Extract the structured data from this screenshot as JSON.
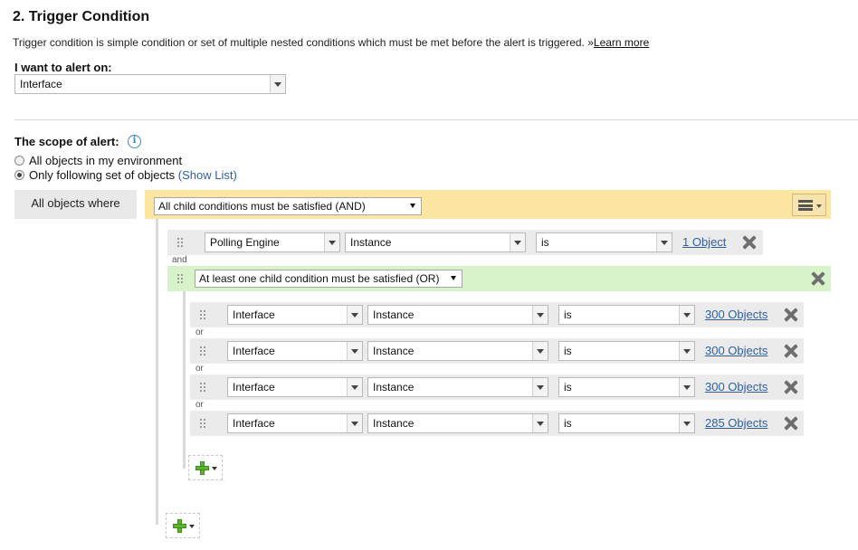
{
  "section": {
    "title": "2. Trigger Condition",
    "description": "Trigger condition is simple condition or set of multiple nested conditions which must be met before the alert is triggered. »",
    "learn_more": "Learn more"
  },
  "alert_on": {
    "label": "I want to alert on:",
    "value": "Interface"
  },
  "scope": {
    "label": "The scope of alert:",
    "info_icon": "info-icon",
    "option_all": "All objects in my environment",
    "option_following": "Only following set of objects",
    "show_list": "(Show List)",
    "selected": "option_following"
  },
  "root": {
    "label": "All objects where",
    "logic": "All child conditions must be satisfied (AND)",
    "menu_icon": "menu-icon",
    "condition": {
      "field": "Polling Engine",
      "property": "Instance",
      "operator": "is",
      "value_link": "1 Object"
    },
    "connector": "and",
    "group": {
      "logic": "At least one child condition must be satisfied (OR)",
      "connector": "or",
      "conditions": [
        {
          "field": "Interface",
          "property": "Instance",
          "operator": "is",
          "value_link": "300 Objects"
        },
        {
          "field": "Interface",
          "property": "Instance",
          "operator": "is",
          "value_link": "300 Objects"
        },
        {
          "field": "Interface",
          "property": "Instance",
          "operator": "is",
          "value_link": "300 Objects"
        },
        {
          "field": "Interface",
          "property": "Instance",
          "operator": "is",
          "value_link": "285 Objects"
        }
      ]
    }
  },
  "colors": {
    "and_group": "#fde6a1",
    "or_group": "#d8f3c9",
    "link": "#2f5f9f",
    "add_icon": "#5cb531"
  }
}
